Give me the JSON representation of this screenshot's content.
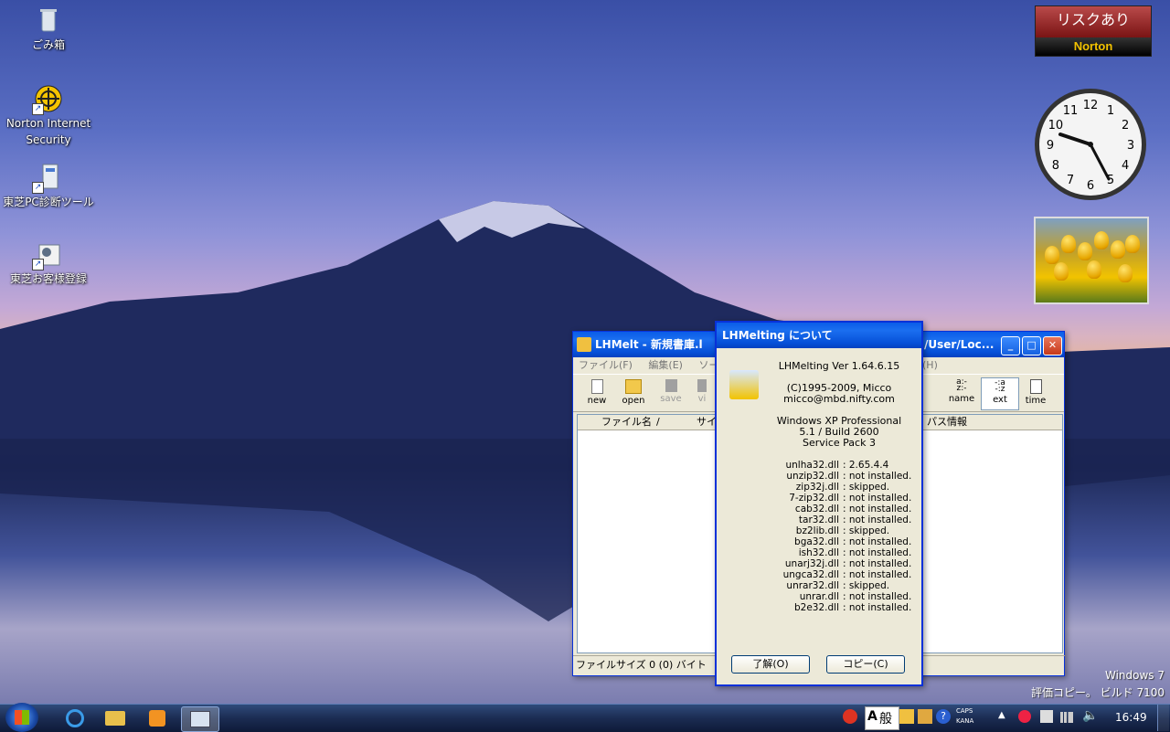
{
  "desktop_icons": [
    {
      "label": "ごみ箱"
    },
    {
      "label": "Norton Internet Security"
    },
    {
      "label": "東芝PC診断ツール"
    },
    {
      "label": "東芝お客様登録"
    }
  ],
  "norton_gadget": {
    "status": "リスクあり",
    "brand": "Norton"
  },
  "clock": {
    "numerals": [
      "12",
      "1",
      "2",
      "3",
      "4",
      "5",
      "6",
      "7",
      "8",
      "9",
      "10",
      "11"
    ]
  },
  "main_window": {
    "title": "LHMelt - 新規書庫.l",
    "title_right": "/User/Loc...",
    "menu": [
      "ファイル(F)",
      "編集(E)",
      "ソート"
    ],
    "menu_right": "(H)",
    "toolbar_left": [
      {
        "label": "new"
      },
      {
        "label": "open"
      },
      {
        "label": "save",
        "disabled": true
      },
      {
        "label": "vi",
        "disabled": true
      }
    ],
    "toolbar_right": [
      {
        "label": "name"
      },
      {
        "label": "ext"
      },
      {
        "label": "time"
      }
    ],
    "columns": {
      "filename": "ファイル名",
      "sort_mark": "/",
      "size": "サイ",
      "path": "パス情報"
    },
    "status": "ファイルサイズ 0 (0) バイト"
  },
  "about_dialog": {
    "title": "LHMelting について",
    "version": "LHMelting Ver 1.64.6.15",
    "copyright": "(C)1995-2009, Micco",
    "email": "micco@mbd.nifty.com",
    "os_lines": [
      "Windows XP Professional",
      "5.1 / Build 2600",
      "Service Pack 3"
    ],
    "dlls": [
      {
        "name": "unlha32.dll",
        "status": ": 2.65.4.4"
      },
      {
        "name": "unzip32.dll",
        "status": ": not installed."
      },
      {
        "name": "zip32j.dll",
        "status": ": skipped."
      },
      {
        "name": "7-zip32.dll",
        "status": ": not installed."
      },
      {
        "name": "cab32.dll",
        "status": ": not installed."
      },
      {
        "name": "tar32.dll",
        "status": ": not installed."
      },
      {
        "name": "bz2lib.dll",
        "status": ": skipped."
      },
      {
        "name": "bga32.dll",
        "status": ": not installed."
      },
      {
        "name": "ish32.dll",
        "status": ": not installed."
      },
      {
        "name": "unarj32j.dll",
        "status": ": not installed."
      },
      {
        "name": "ungca32.dll",
        "status": ": not installed."
      },
      {
        "name": "unrar32.dll",
        "status": ": skipped."
      },
      {
        "name": "unrar.dll",
        "status": ": not installed."
      },
      {
        "name": "b2e32.dll",
        "status": ": not installed."
      }
    ],
    "ok_button": "了解(O)",
    "copy_button": "コピー(C)"
  },
  "watermark": {
    "line1": "Windows 7",
    "line2": "評価コピー。 ビルド 7100"
  },
  "tray": {
    "ime_a": "A",
    "ime_mode": "般",
    "caps": "CAPS",
    "kana": "KANA",
    "help": "?",
    "time": "16:49"
  },
  "colors": {
    "title_blue": "#0a5ce8",
    "norton_red": "#9a2020",
    "taskbar": "#1b2c52"
  }
}
